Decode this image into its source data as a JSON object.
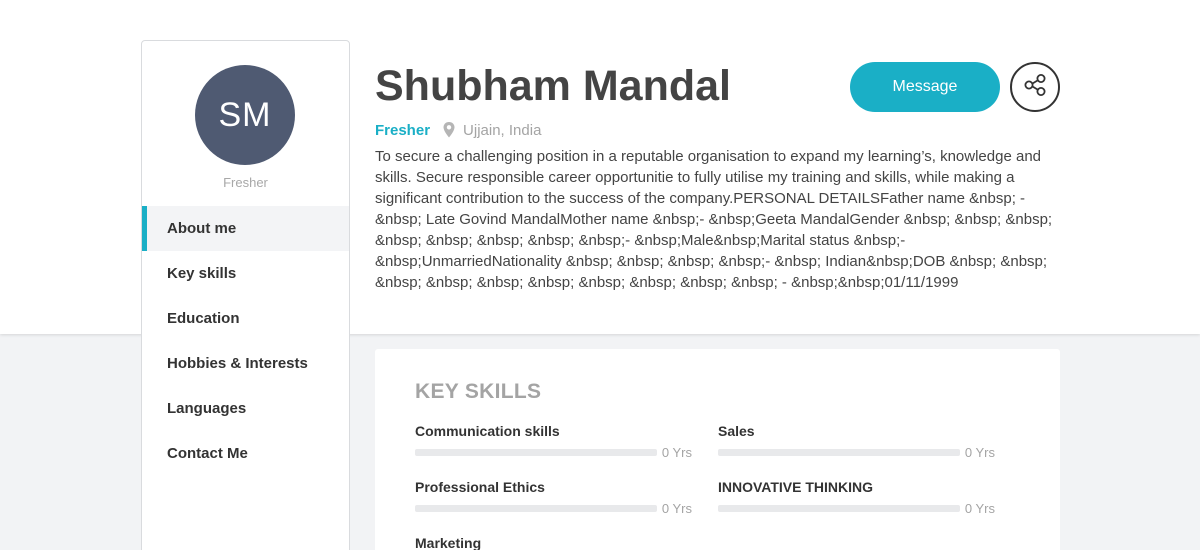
{
  "profile": {
    "initials": "SM",
    "side_role": "Fresher",
    "name": "Shubham Mandal",
    "role": "Fresher",
    "location": "Ujjain, India",
    "summary": "To secure a challenging position in a reputable organisation to expand my learning’s, knowledge and skills. Secure responsible career opportunitie to fully utilise my training and skills, while making a significant contribution to the success of the company.PERSONAL DETAILSFather name &nbsp; - &nbsp; Late Govind MandalMother name &nbsp;- &nbsp;Geeta MandalGender &nbsp; &nbsp; &nbsp; &nbsp; &nbsp; &nbsp; &nbsp; &nbsp;- &nbsp;Male&nbsp;Marital status &nbsp;- &nbsp;UnmarriedNationality &nbsp; &nbsp; &nbsp; &nbsp;- &nbsp; Indian&nbsp;DOB &nbsp; &nbsp; &nbsp; &nbsp; &nbsp; &nbsp; &nbsp; &nbsp; &nbsp; &nbsp; - &nbsp;&nbsp;01/11/1999"
  },
  "actions": {
    "message_label": "Message",
    "share_icon": "share-icon"
  },
  "sidebar": {
    "items": [
      {
        "label": "About me",
        "active": true
      },
      {
        "label": "Key skills",
        "active": false
      },
      {
        "label": "Education",
        "active": false
      },
      {
        "label": "Hobbies & Interests",
        "active": false
      },
      {
        "label": "Languages",
        "active": false
      },
      {
        "label": "Contact Me",
        "active": false
      }
    ]
  },
  "skills": {
    "title": "KEY SKILLS",
    "items": [
      {
        "name": "Communication skills",
        "years": "0 Yrs",
        "level": 0
      },
      {
        "name": "Sales",
        "years": "0 Yrs",
        "level": 0
      },
      {
        "name": "Professional Ethics",
        "years": "0 Yrs",
        "level": 0
      },
      {
        "name": "INNOVATIVE THINKING",
        "years": "0 Yrs",
        "level": 0
      },
      {
        "name": "Marketing",
        "years": "",
        "level": 0
      }
    ]
  },
  "colors": {
    "accent": "#1aafc6",
    "avatar_bg": "#4f5a72"
  }
}
